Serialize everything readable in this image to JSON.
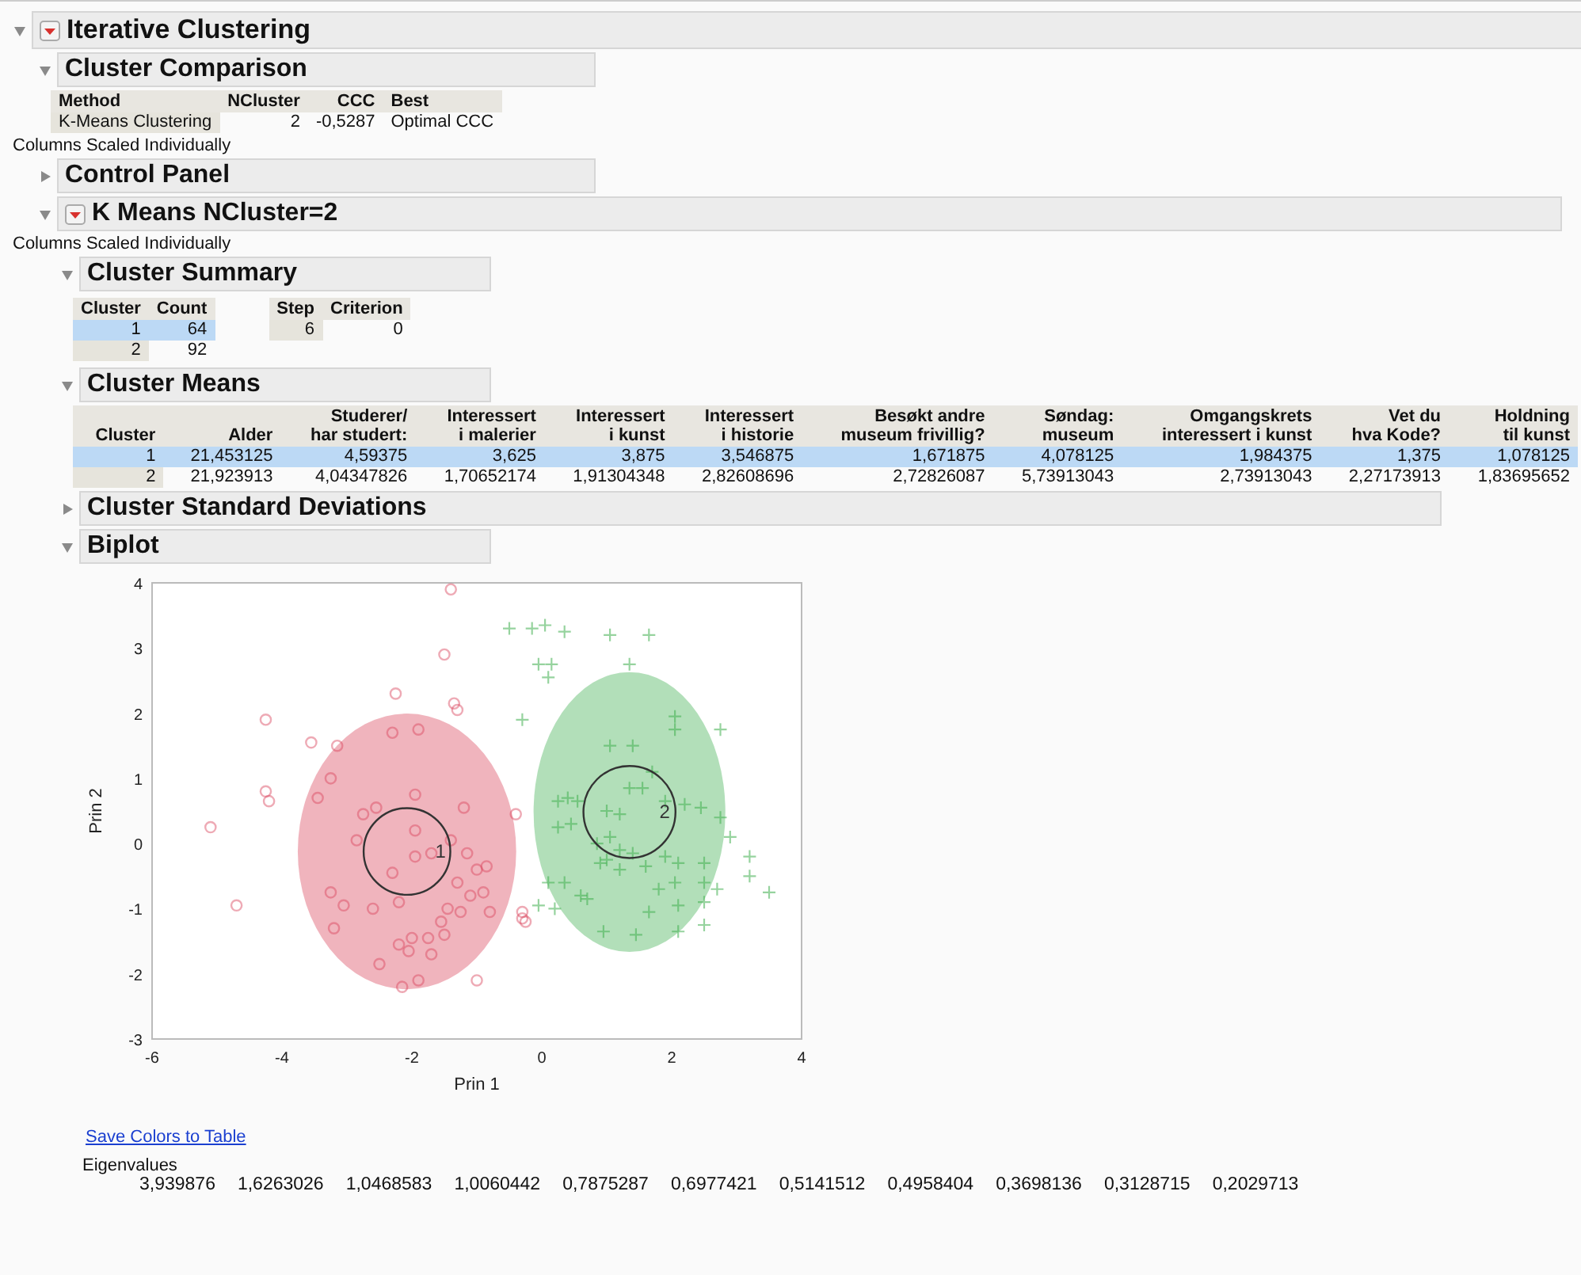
{
  "report": {
    "title": "Iterative Clustering",
    "expanded": true,
    "menu": true
  },
  "comparison": {
    "title": "Cluster Comparison",
    "expanded": true,
    "columns": [
      "Method",
      "NCluster",
      "CCC",
      "Best"
    ],
    "rows": [
      [
        "K-Means Clustering",
        "2",
        "-0,5287",
        "Optimal CCC"
      ]
    ]
  },
  "comparison_note": "Columns Scaled Individually",
  "control_panel": {
    "title": "Control Panel",
    "expanded": false
  },
  "kmeans": {
    "title": "K Means NCluster=2",
    "expanded": true,
    "menu": true,
    "note": "Columns Scaled Individually",
    "summary": {
      "title": "Cluster Summary",
      "expanded": true,
      "columns": [
        "Cluster",
        "Count"
      ],
      "rows": [
        {
          "cells": [
            "1",
            "64"
          ],
          "selected": true
        },
        {
          "cells": [
            "2",
            "92"
          ],
          "selected": false
        }
      ],
      "step_columns": [
        "Step",
        "Criterion"
      ],
      "step_row": [
        "6",
        "0"
      ]
    },
    "means": {
      "title": "Cluster Means",
      "expanded": true,
      "columns": [
        "Cluster",
        "Alder",
        "Studerer/\nhar studert:",
        "Interessert\ni malerier",
        "Interessert\ni kunst",
        "Interessert\ni historie",
        "Besøkt andre\nmuseum frivillig?",
        "Søndag:\nmuseum",
        "Omgangskrets\ninteressert i kunst",
        "Vet du\nhva Kode?",
        "Holdning\ntil kunst"
      ],
      "rows": [
        {
          "cells": [
            "1",
            "21,453125",
            "4,59375",
            "3,625",
            "3,875",
            "3,546875",
            "1,671875",
            "4,078125",
            "1,984375",
            "1,375",
            "1,078125"
          ],
          "selected": true
        },
        {
          "cells": [
            "2",
            "21,923913",
            "4,04347826",
            "1,70652174",
            "1,91304348",
            "2,82608696",
            "2,72826087",
            "5,73913043",
            "2,73913043",
            "2,27173913",
            "1,83695652"
          ],
          "selected": false
        }
      ]
    },
    "std_dev": {
      "title": "Cluster Standard Deviations",
      "expanded": false
    },
    "biplot": {
      "title": "Biplot",
      "expanded": true,
      "chart_data": {
        "type": "scatter",
        "xlabel": "Prin 1",
        "ylabel": "Prin 2",
        "xlim": [
          -6,
          4
        ],
        "ylim": [
          -3,
          4
        ],
        "xticks": [
          {
            "value": -6,
            "label": "-6"
          },
          {
            "value": -4,
            "label": "-4"
          },
          {
            "value": -2,
            "label": "-2"
          },
          {
            "value": 0,
            "label": "0"
          },
          {
            "value": 2,
            "label": "2"
          },
          {
            "value": 4,
            "label": "4"
          }
        ],
        "yticks": [
          {
            "value": -3,
            "label": "-3"
          },
          {
            "value": -2,
            "label": "-2"
          },
          {
            "value": -1,
            "label": "-1"
          },
          {
            "value": 0,
            "label": "0"
          },
          {
            "value": 1,
            "label": "1"
          },
          {
            "value": 2,
            "label": "2"
          },
          {
            "value": 3,
            "label": "3"
          },
          {
            "value": 4,
            "label": "4"
          }
        ],
        "series": [
          {
            "name": "1",
            "color": "#d9435a",
            "x": [
              -5.1,
              -4.7,
              -4.2,
              -4.25,
              -4.25,
              -3.55,
              -3.15,
              -3.25,
              -3.45,
              -2.75,
              -2.55,
              -2.85,
              -3.25,
              -3.05,
              -2.6,
              -2.3,
              -2.3,
              -2.25,
              -1.5,
              -1.4,
              -1.35,
              -1.3,
              -1.9,
              -1.95,
              -1.95,
              -1.95,
              -1.7,
              -1.2,
              -1.4,
              -1.15,
              -1,
              -0.85,
              -1.3,
              -1.1,
              -0.9,
              -1.25,
              -1.45,
              -1.55,
              -1.5,
              -1.75,
              -2,
              -2.2,
              -2.05,
              -1.7,
              -2.5,
              -1.9,
              -2.15,
              -1,
              -3.2,
              -2.2,
              -0.4,
              -0.3,
              -0.3,
              -0.25,
              -0.8
            ],
            "values": [
              0.25,
              -0.95,
              0.65,
              0.8,
              1.9,
              1.55,
              1.5,
              1,
              0.7,
              0.45,
              0.55,
              0.05,
              -0.75,
              -0.95,
              -1,
              -0.45,
              1.7,
              2.3,
              2.9,
              3.9,
              2.15,
              2.05,
              1.75,
              0.75,
              0.2,
              -0.2,
              -0.15,
              0.55,
              0.05,
              -0.15,
              -0.4,
              -0.35,
              -0.6,
              -0.8,
              -0.75,
              -1.05,
              -1,
              -1.2,
              -1.4,
              -1.45,
              -1.45,
              -1.55,
              -1.65,
              -1.7,
              -1.85,
              -2.1,
              -2.2,
              -2.1,
              -1.3,
              -0.9,
              0.45,
              -1.05,
              -1.15,
              -1.2,
              -1.05
            ]
          },
          {
            "name": "2",
            "color": "#3fae4f",
            "x": [
              -0.5,
              -0.15,
              0.05,
              0.35,
              1.05,
              1.65,
              -0.05,
              0.15,
              0.1,
              1.35,
              -0.3,
              2.05,
              2.05,
              2.75,
              1.05,
              1.4,
              1.7,
              0.25,
              0.4,
              0.55,
              0.25,
              0.45,
              1,
              1.2,
              1.35,
              1.55,
              1.9,
              2.2,
              2.45,
              2.75,
              2.9,
              0.85,
              1.05,
              1.2,
              1,
              1.4,
              1.9,
              2.1,
              2.5,
              3.2,
              3.2,
              3.5,
              0.1,
              0.35,
              0.6,
              0.9,
              1.2,
              1.6,
              2.05,
              2.5,
              2.7,
              0.2,
              0.7,
              1.65,
              2.1,
              2.5,
              0.95,
              1.45,
              2.1,
              2.5,
              -0.05,
              1.8
            ],
            "values": [
              3.3,
              3.3,
              3.35,
              3.25,
              3.2,
              3.2,
              2.75,
              2.75,
              2.55,
              2.75,
              1.9,
              1.95,
              1.75,
              1.75,
              1.5,
              1.5,
              1.1,
              0.65,
              0.7,
              0.65,
              0.25,
              0.3,
              0.5,
              0.45,
              0.85,
              0.85,
              0.65,
              0.6,
              0.55,
              0.4,
              0.1,
              0,
              0.1,
              -0.1,
              -0.25,
              -0.15,
              -0.2,
              -0.3,
              -0.3,
              -0.2,
              -0.5,
              -0.75,
              -0.6,
              -0.6,
              -0.8,
              -0.3,
              -0.4,
              -0.35,
              -0.6,
              -0.6,
              -0.7,
              -1,
              -0.85,
              -1.05,
              -0.95,
              -0.9,
              -1.35,
              -1.4,
              -1.35,
              -1.25,
              -0.95,
              -0.7
            ]
          }
        ]
      },
      "link": "Save Colors to Table",
      "eigen_label": "Eigenvalues",
      "eigenvalues": [
        "3,939876",
        "1,6263026",
        "1,0468583",
        "1,0060442",
        "0,7875287",
        "0,6977421",
        "0,5141512",
        "0,4958404",
        "0,3698136",
        "0,3128715",
        "0,2029713"
      ]
    }
  }
}
